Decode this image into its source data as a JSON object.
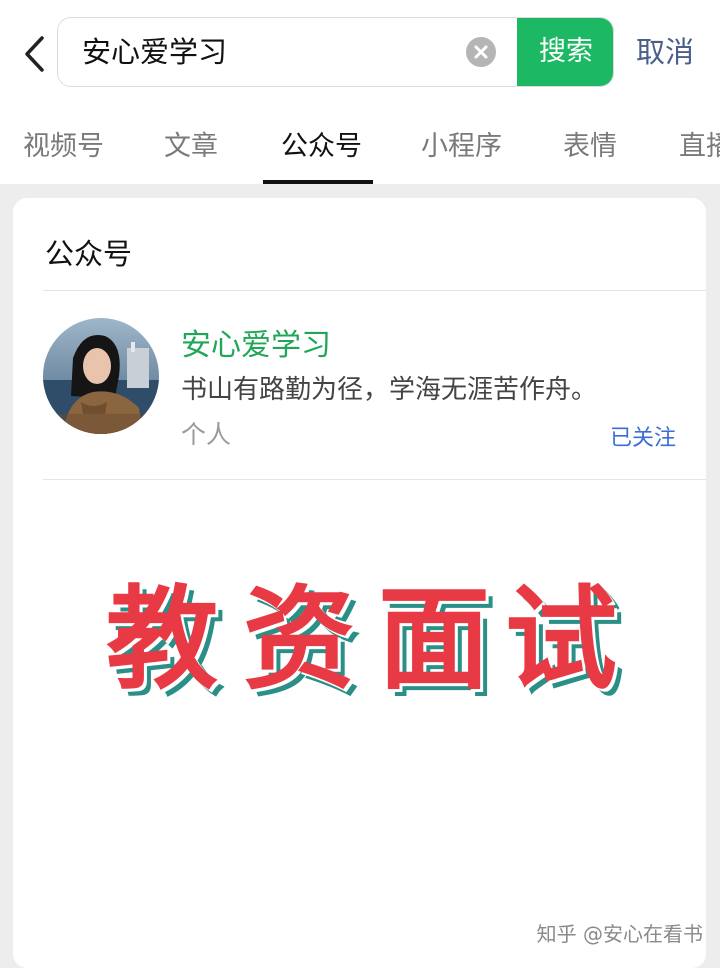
{
  "search": {
    "query": "安心爱学习",
    "search_label": "搜索",
    "cancel_label": "取消"
  },
  "tabs": [
    {
      "label": "视频号",
      "active": false
    },
    {
      "label": "文章",
      "active": false
    },
    {
      "label": "公众号",
      "active": true
    },
    {
      "label": "小程序",
      "active": false
    },
    {
      "label": "表情",
      "active": false
    },
    {
      "label": "直播",
      "active": false
    }
  ],
  "results": {
    "section_title": "公众号",
    "account": {
      "name": "安心爱学习",
      "description": "书山有路勤为径，学海无涯苦作舟。",
      "type": "个人",
      "follow_status": "已关注"
    }
  },
  "banner": {
    "chars": [
      "教",
      "资",
      "面",
      "试"
    ]
  },
  "watermark": "知乎 @安心在看书",
  "colors": {
    "accent_green": "#1db863",
    "name_green": "#1fa757",
    "link_blue": "#3b6fd6",
    "banner_red": "#e83a44",
    "banner_shadow": "#2a8f86"
  },
  "icons": {
    "back": "chevron-left-icon",
    "clear": "clear-icon"
  }
}
